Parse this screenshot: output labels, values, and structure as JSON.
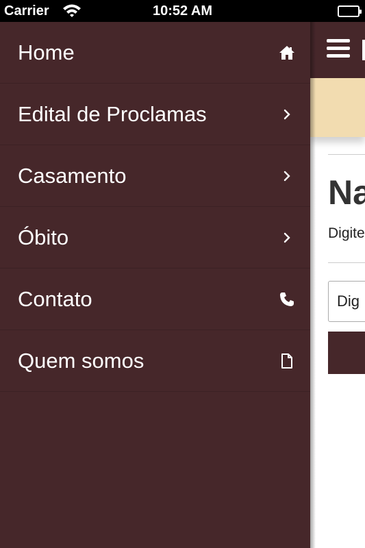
{
  "status_bar": {
    "carrier": "Carrier",
    "time": "10:52 AM"
  },
  "drawer": {
    "background": "#46272a",
    "items": [
      {
        "label": "Home",
        "icon": "home-icon"
      },
      {
        "label": "Edital de Proclamas",
        "icon": "chevron-right-icon"
      },
      {
        "label": "Casamento",
        "icon": "chevron-right-icon"
      },
      {
        "label": "Óbito",
        "icon": "chevron-right-icon"
      },
      {
        "label": "Contato",
        "icon": "phone-icon"
      },
      {
        "label": "Quem somos",
        "icon": "document-icon"
      }
    ]
  },
  "main": {
    "heading": "Na",
    "subtext": "Digite",
    "input_value": "Dig",
    "banner_color": "#f2dcb0"
  }
}
